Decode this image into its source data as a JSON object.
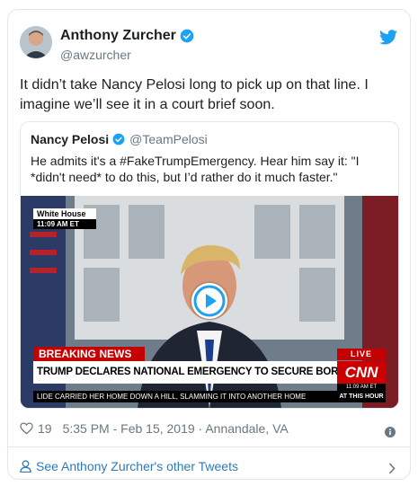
{
  "author": {
    "name": "Anthony Zurcher",
    "handle": "@awzurcher"
  },
  "tweet": {
    "text": "It didn’t take Nancy Pelosi long to pick up on that line. I imagine we’ll see it in a court brief soon."
  },
  "quoted_tweet": {
    "name": "Nancy Pelosi",
    "handle": "@TeamPelosi",
    "text": "He admits it's a #FakeTrumpEmergency. Hear him say it: \"I *didn't need* to do this, but I’d rather do it much faster.\""
  },
  "video": {
    "source_label": "White House",
    "source_time": "11:09 AM ET",
    "breaking_label": "BREAKING NEWS",
    "headline": "TRUMP DECLARES NATIONAL EMERGENCY TO SECURE BORDER WALL FUNDING",
    "live_label": "LIVE",
    "network": "CNN",
    "network_time": "11:09 AM ET",
    "ticker": "LIDE CARRIED HER HOME DOWN A HILL, SLAMMING IT INTO ANOTHER HOME",
    "ticker_tag": "AT THIS HOUR"
  },
  "meta": {
    "likes": "19",
    "timestamp": "5:35 PM - Feb 15, 2019 · Annandale, VA"
  },
  "footer": {
    "link": "See Anthony Zurcher's other Tweets"
  },
  "colors": {
    "twitter_blue": "#1da1f2",
    "link_blue": "#2b7bb9",
    "muted_gray": "#697882",
    "cnn_red": "#cc0000"
  },
  "icons": [
    "twitter-bird-icon",
    "verified-badge-icon",
    "play-icon",
    "heart-icon",
    "info-icon",
    "person-icon",
    "chevron-right-icon"
  ]
}
